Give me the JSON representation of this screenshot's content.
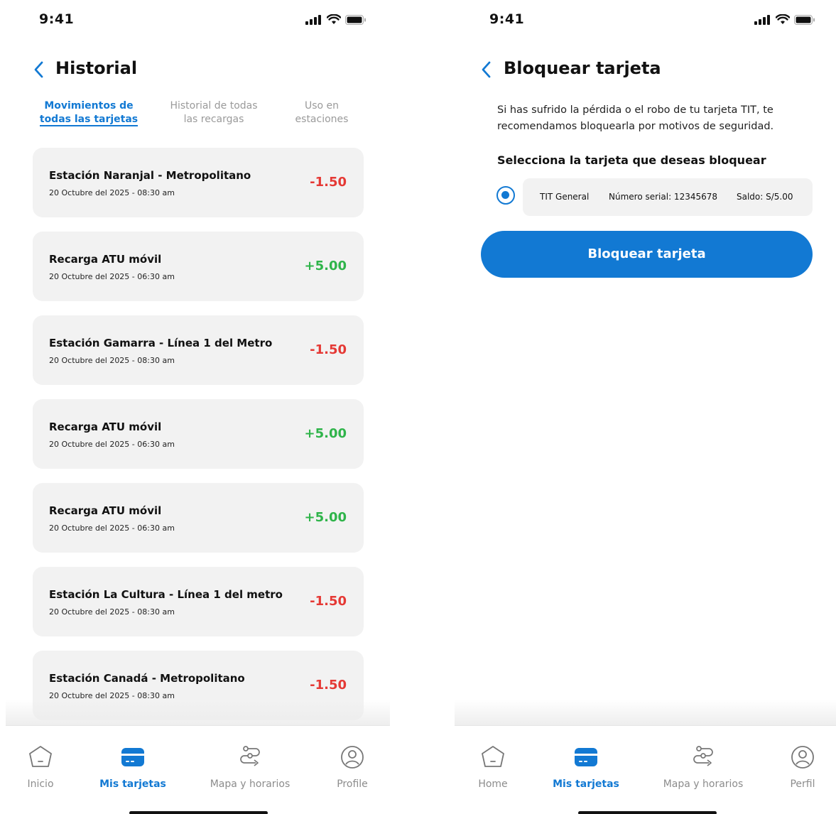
{
  "colors": {
    "accent": "#1279d3",
    "negative": "#e53935",
    "positive": "#2fb44a",
    "card_bg": "#f2f2f2",
    "inactive": "#8c8c8c"
  },
  "left_screen": {
    "status_time": "9:41",
    "title": "Historial",
    "tabs": [
      {
        "line1": "Movimientos de",
        "line2": "todas las tarjetas",
        "active": true
      },
      {
        "line1": "Historial de todas",
        "line2": "las recargas",
        "active": false
      },
      {
        "line1": "Uso en",
        "line2": "estaciones",
        "active": false
      }
    ],
    "movements": [
      {
        "title": "Estación Naranjal - Metropolitano",
        "date": "20 Octubre del 2025 - 08:30 am",
        "amount": "-1.50",
        "type": "negative"
      },
      {
        "title": "Recarga ATU móvil",
        "date": "20 Octubre del 2025 - 06:30 am",
        "amount": "+5.00",
        "type": "positive"
      },
      {
        "title": "Estación Gamarra - Línea 1 del Metro",
        "date": "20 Octubre del 2025 - 08:30 am",
        "amount": "-1.50",
        "type": "negative"
      },
      {
        "title": "Recarga ATU móvil",
        "date": "20 Octubre del 2025 - 06:30 am",
        "amount": "+5.00",
        "type": "positive"
      },
      {
        "title": "Recarga ATU móvil",
        "date": "20 Octubre del 2025 - 06:30 am",
        "amount": "+5.00",
        "type": "positive"
      },
      {
        "title": "Estación La Cultura - Línea 1 del metro",
        "date": "20 Octubre del 2025 - 08:30 am",
        "amount": "-1.50",
        "type": "negative"
      },
      {
        "title": "Estación Canadá - Metropolitano",
        "date": "20 Octubre del 2025 - 08:30 am",
        "amount": "-1.50",
        "type": "negative"
      }
    ],
    "nav": {
      "home": "Inicio",
      "cards": "Mis tarjetas",
      "map": "Mapa y horarios",
      "profile": "Profile"
    }
  },
  "right_screen": {
    "status_time": "9:41",
    "title": "Bloquear tarjeta",
    "description": "Si has sufrido la pérdida o el robo de tu tarjeta TIT, te recomendamos bloquearla por motivos de seguridad.",
    "select_label": "Selecciona la tarjeta que deseas bloquear",
    "card_option": {
      "name": "TIT General",
      "serial": "Número serial: 12345678",
      "balance": "Saldo: S/5.00",
      "selected": true
    },
    "button_label": "Bloquear tarjeta",
    "nav": {
      "home": "Home",
      "cards": "Mis tarjetas",
      "map": "Mapa y horarios",
      "profile": "Perfil"
    }
  }
}
